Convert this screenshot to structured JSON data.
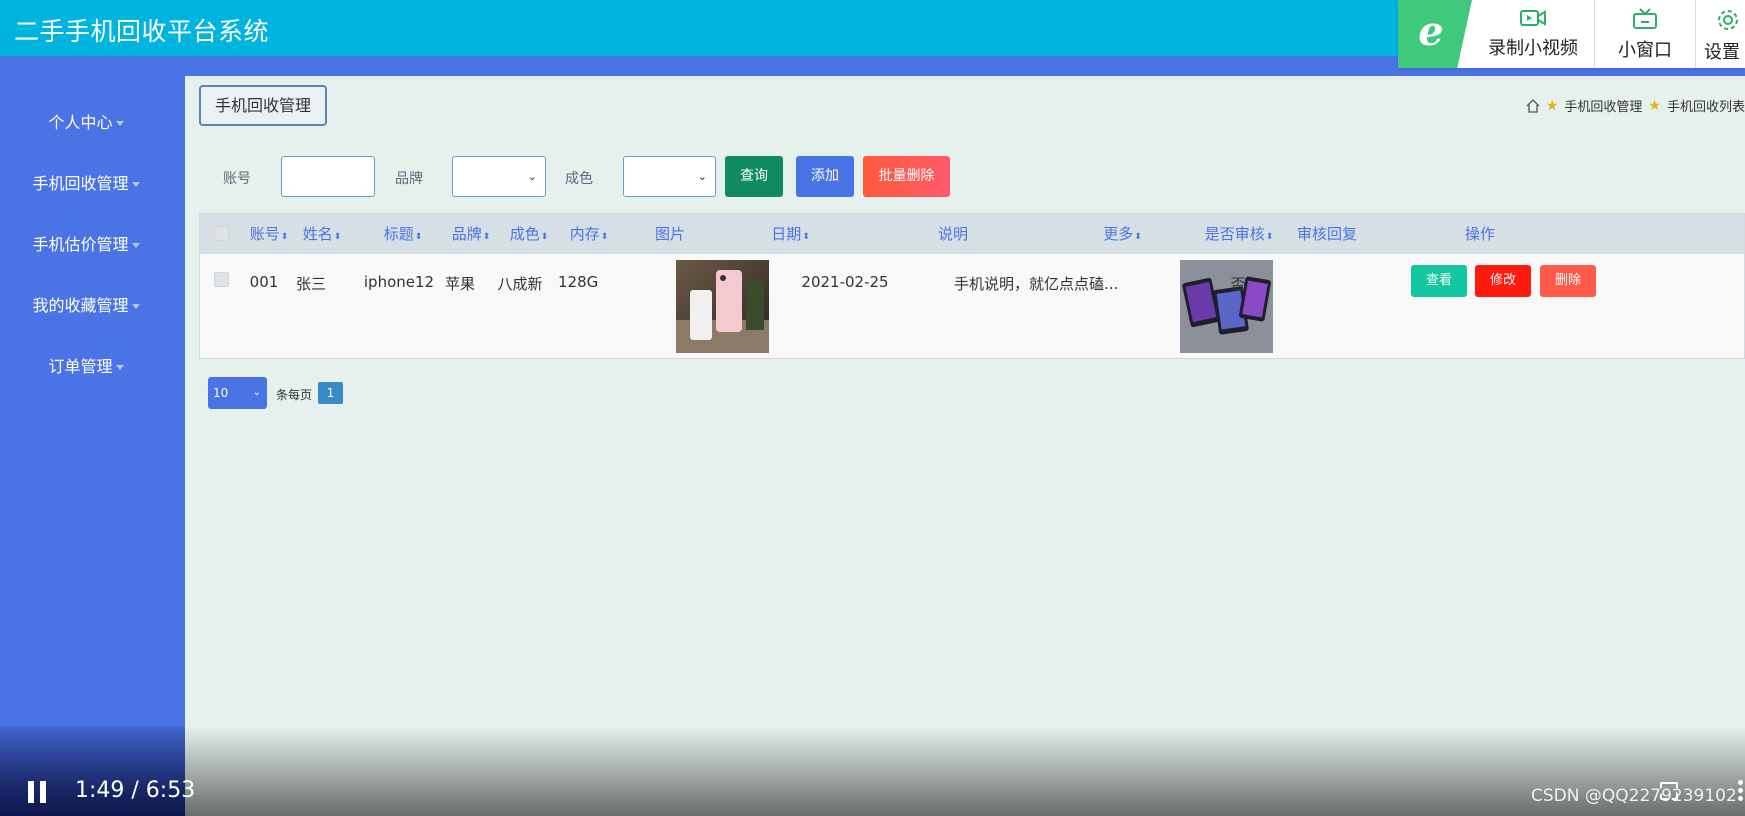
{
  "app": {
    "title": "二手手机回收平台系统"
  },
  "overlay": {
    "record_label": "录制小视频",
    "window_label": "小窗口",
    "settings_label": "设置"
  },
  "sidebar": {
    "items": [
      {
        "label": "个人中心"
      },
      {
        "label": "手机回收管理"
      },
      {
        "label": "手机估价管理"
      },
      {
        "label": "我的收藏管理"
      },
      {
        "label": "订单管理"
      }
    ]
  },
  "page": {
    "title_button": "手机回收管理",
    "breadcrumb": [
      "手机回收管理",
      "手机回收列表"
    ]
  },
  "search": {
    "account_label": "账号",
    "brand_label": "品牌",
    "condition_label": "成色",
    "query_button": "查询",
    "add_button": "添加",
    "batch_delete_button": "批量删除"
  },
  "table": {
    "headers": [
      "账号",
      "姓名",
      "标题",
      "品牌",
      "成色",
      "内存",
      "图片",
      "日期",
      "说明",
      "更多",
      "是否审核",
      "审核回复",
      "操作"
    ],
    "rows": [
      {
        "account": "001",
        "name": "张三",
        "title": "iphone12",
        "brand": "苹果",
        "condition": "八成新",
        "memory": "128G",
        "date": "2021-02-25",
        "description": "手机说明，就亿点点磕...",
        "approved": "否",
        "reply": "",
        "view_button": "查看",
        "edit_button": "修改",
        "delete_button": "删除"
      }
    ]
  },
  "pagination": {
    "page_size": "10",
    "page_size_label": "条每页",
    "current_page": "1"
  },
  "player": {
    "time": "1:49 / 6:53",
    "watermark": "CSDN @QQ2279239102"
  },
  "colors": {
    "header": "#00b4e0",
    "sidebar": "#4a74e5",
    "query_button": "#0f8a62",
    "add_button": "#4a74e5",
    "batch_delete_button": "#ff5a3c",
    "view_button": "#13c8a0",
    "edit_button": "#ff1a0e",
    "delete_button": "#ff5a4a"
  }
}
